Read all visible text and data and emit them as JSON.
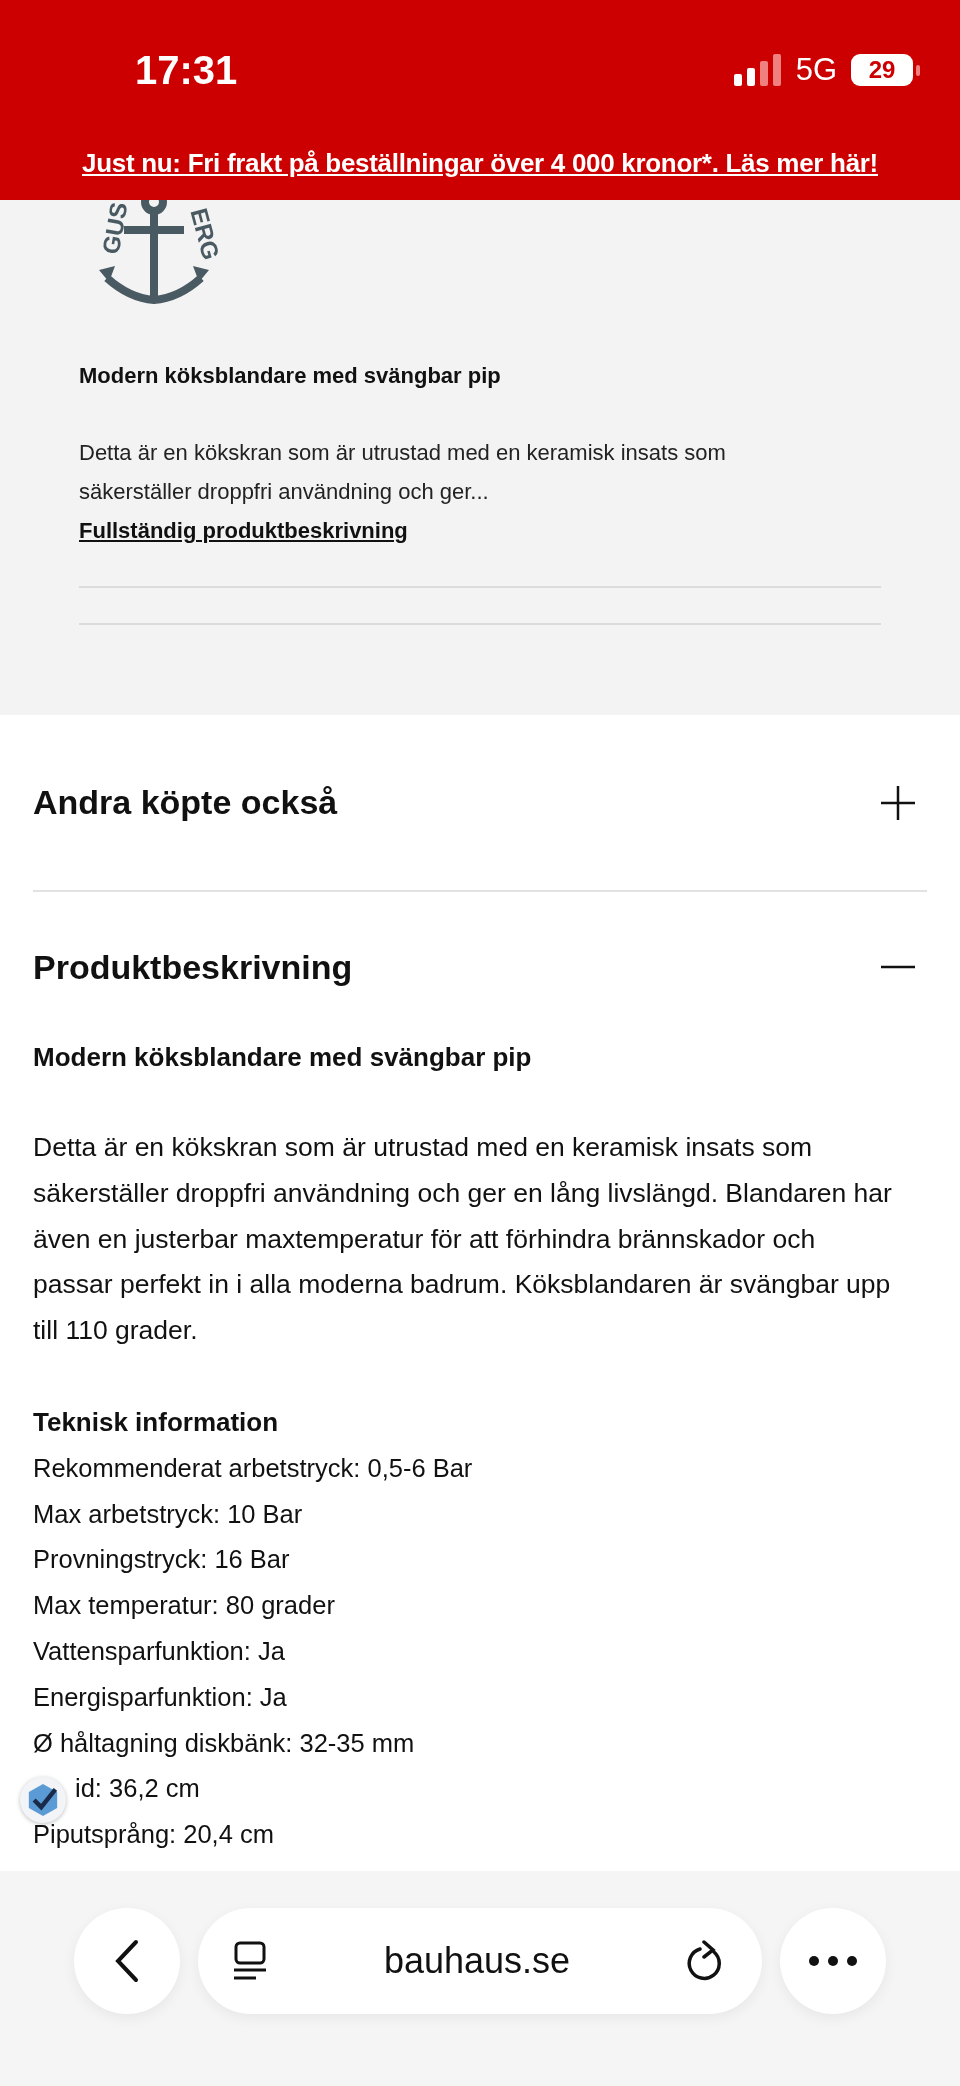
{
  "status_bar": {
    "time": "17:31",
    "network": "5G",
    "battery": "29"
  },
  "banner": {
    "text": "Just nu: Fri frakt på beställningar över 4 000 kronor*. Läs mer här!"
  },
  "summary": {
    "logo_left": "GUS",
    "logo_right": "ERG",
    "title": "Modern köksblandare med svängbar pip",
    "description": "Detta är en kökskran som är utrustad med en keramisk insats som säkerställer droppfri användning och ger...",
    "link": "Fullständig produktbeskrivning"
  },
  "sections": [
    {
      "title": "Andra köpte också",
      "expanded": false
    },
    {
      "title": "Produktbeskrivning",
      "expanded": true,
      "subtitle": "Modern köksblandare med svängbar pip",
      "body": "Detta är en kökskran som är utrustad med en keramisk insats som säkerställer droppfri användning och ger en lång livslängd. Blandaren har även en justerbar maxtemperatur för att förhindra brännskador och passar perfekt in i alla moderna badrum. Köksblandaren är svängbar upp till 110 grader.",
      "specs_title": "Teknisk information",
      "specs": [
        "Rekommenderat arbetstryck: 0,5-6 Bar",
        "Max arbetstryck: 10 Bar",
        "Provningstryck: 16 Bar",
        "Max temperatur: 80 grader",
        "Vattensparfunktion: Ja",
        "Energisparfunktion: Ja",
        "Ø håltagning diskbänk: 32-35 mm",
        "id: 36,2 cm",
        "Piputsprång: 20,4 cm"
      ]
    }
  ],
  "browser_bar": {
    "url": "bauhaus.se"
  }
}
